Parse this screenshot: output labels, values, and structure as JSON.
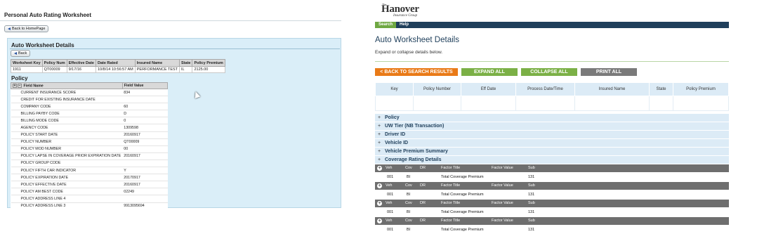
{
  "left": {
    "page_title": "Personal Auto Rating Worksheet",
    "back_home": "Back to HomePage",
    "panel_title": "Auto Worksheet Details",
    "back": "Back",
    "key_headers": [
      "Worksheet Key",
      "Policy Num",
      "Effective Date",
      "Date Rated",
      "Insured Name",
      "State",
      "Policy Premium"
    ],
    "key_values": [
      "1911",
      "QT00009",
      "9/17/16",
      "10/8/14 10:56:57 AM",
      "PERFORMANCE TEST",
      "IL",
      "2125.00"
    ],
    "policy_heading": "Policy",
    "field_headers": [
      "Field Name",
      "Field Value"
    ],
    "fields": [
      {
        "name": "CURRENT INSURANCE SCORE",
        "value": "834"
      },
      {
        "name": "CREDIT FOR EXISTING INSURANCE DATE",
        "value": ""
      },
      {
        "name": "COMPANY CODE",
        "value": "60"
      },
      {
        "name": "BILLING PAYBY CODE",
        "value": "D"
      },
      {
        "name": "BILLING MODE CODE",
        "value": "0"
      },
      {
        "name": "AGENCY CODE",
        "value": "1309598"
      },
      {
        "name": "POLICY START DATE",
        "value": "20160917"
      },
      {
        "name": "POLICY NUMBER",
        "value": "QT00009"
      },
      {
        "name": "POLICY MOD NUMBER",
        "value": "00"
      },
      {
        "name": "POLICY LAPSE IN COVERAGE PRIOR EXPIRATION DATE",
        "value": "20160917"
      },
      {
        "name": "POLICY GROUP CODE",
        "value": ""
      },
      {
        "name": "POLICY FIFTH CAR INDICATOR",
        "value": "Y"
      },
      {
        "name": "POLICY EXPIRATION DATE",
        "value": "20170917"
      },
      {
        "name": "POLICY EFFECTIVE DATE",
        "value": "20160917"
      },
      {
        "name": "POLICY AM BEST CODE",
        "value": "02249"
      },
      {
        "name": "POLICY ADDRESS LINE 4",
        "value": ""
      },
      {
        "name": "POLICY ADDRESS LINE 3",
        "value": "9913095694"
      }
    ]
  },
  "right": {
    "logo_the": "The",
    "logo": "Hanover",
    "logo_sub": "Insurance Group",
    "nav": [
      "Search",
      "Help"
    ],
    "title": "Auto Worksheet Details",
    "subtitle": "Expand or collapse details below.",
    "buttons": {
      "back": "< BACK TO SEARCH RESULTS",
      "expand": "EXPAND ALL",
      "collapse": "COLLAPSE ALL",
      "print": "PRINT ALL"
    },
    "key_headers": [
      "Key",
      "Policy Number",
      "Eff Date",
      "Process Date/Time",
      "Insured Name",
      "State",
      "Policy Premium"
    ],
    "sections": [
      "Policy",
      "UW Tier (NB Transaction)",
      "Driver ID",
      "Vehicle ID",
      "Vehicle Premium Summary",
      "Coverage Rating Details"
    ],
    "coverage_headers": {
      "veh": "Veh",
      "cov": "Cov",
      "dr": "DR",
      "factor_title": "Factor Title",
      "factor_value": "Factor Value",
      "sub": "Sub"
    },
    "coverage_rows": [
      {
        "veh": "001",
        "cov": "BI",
        "dr": "",
        "factor_title": "Total Coverage Premium",
        "factor_value": "",
        "sub": "131"
      },
      {
        "veh": "001",
        "cov": "BI",
        "dr": "",
        "factor_title": "Total Coverage Premium",
        "factor_value": "",
        "sub": "131"
      },
      {
        "veh": "001",
        "cov": "BI",
        "dr": "",
        "factor_title": "Total Coverage Premium",
        "factor_value": "",
        "sub": "131"
      },
      {
        "veh": "001",
        "cov": "BI",
        "dr": "",
        "factor_title": "Total Coverage Premium",
        "factor_value": "",
        "sub": "131"
      }
    ]
  }
}
